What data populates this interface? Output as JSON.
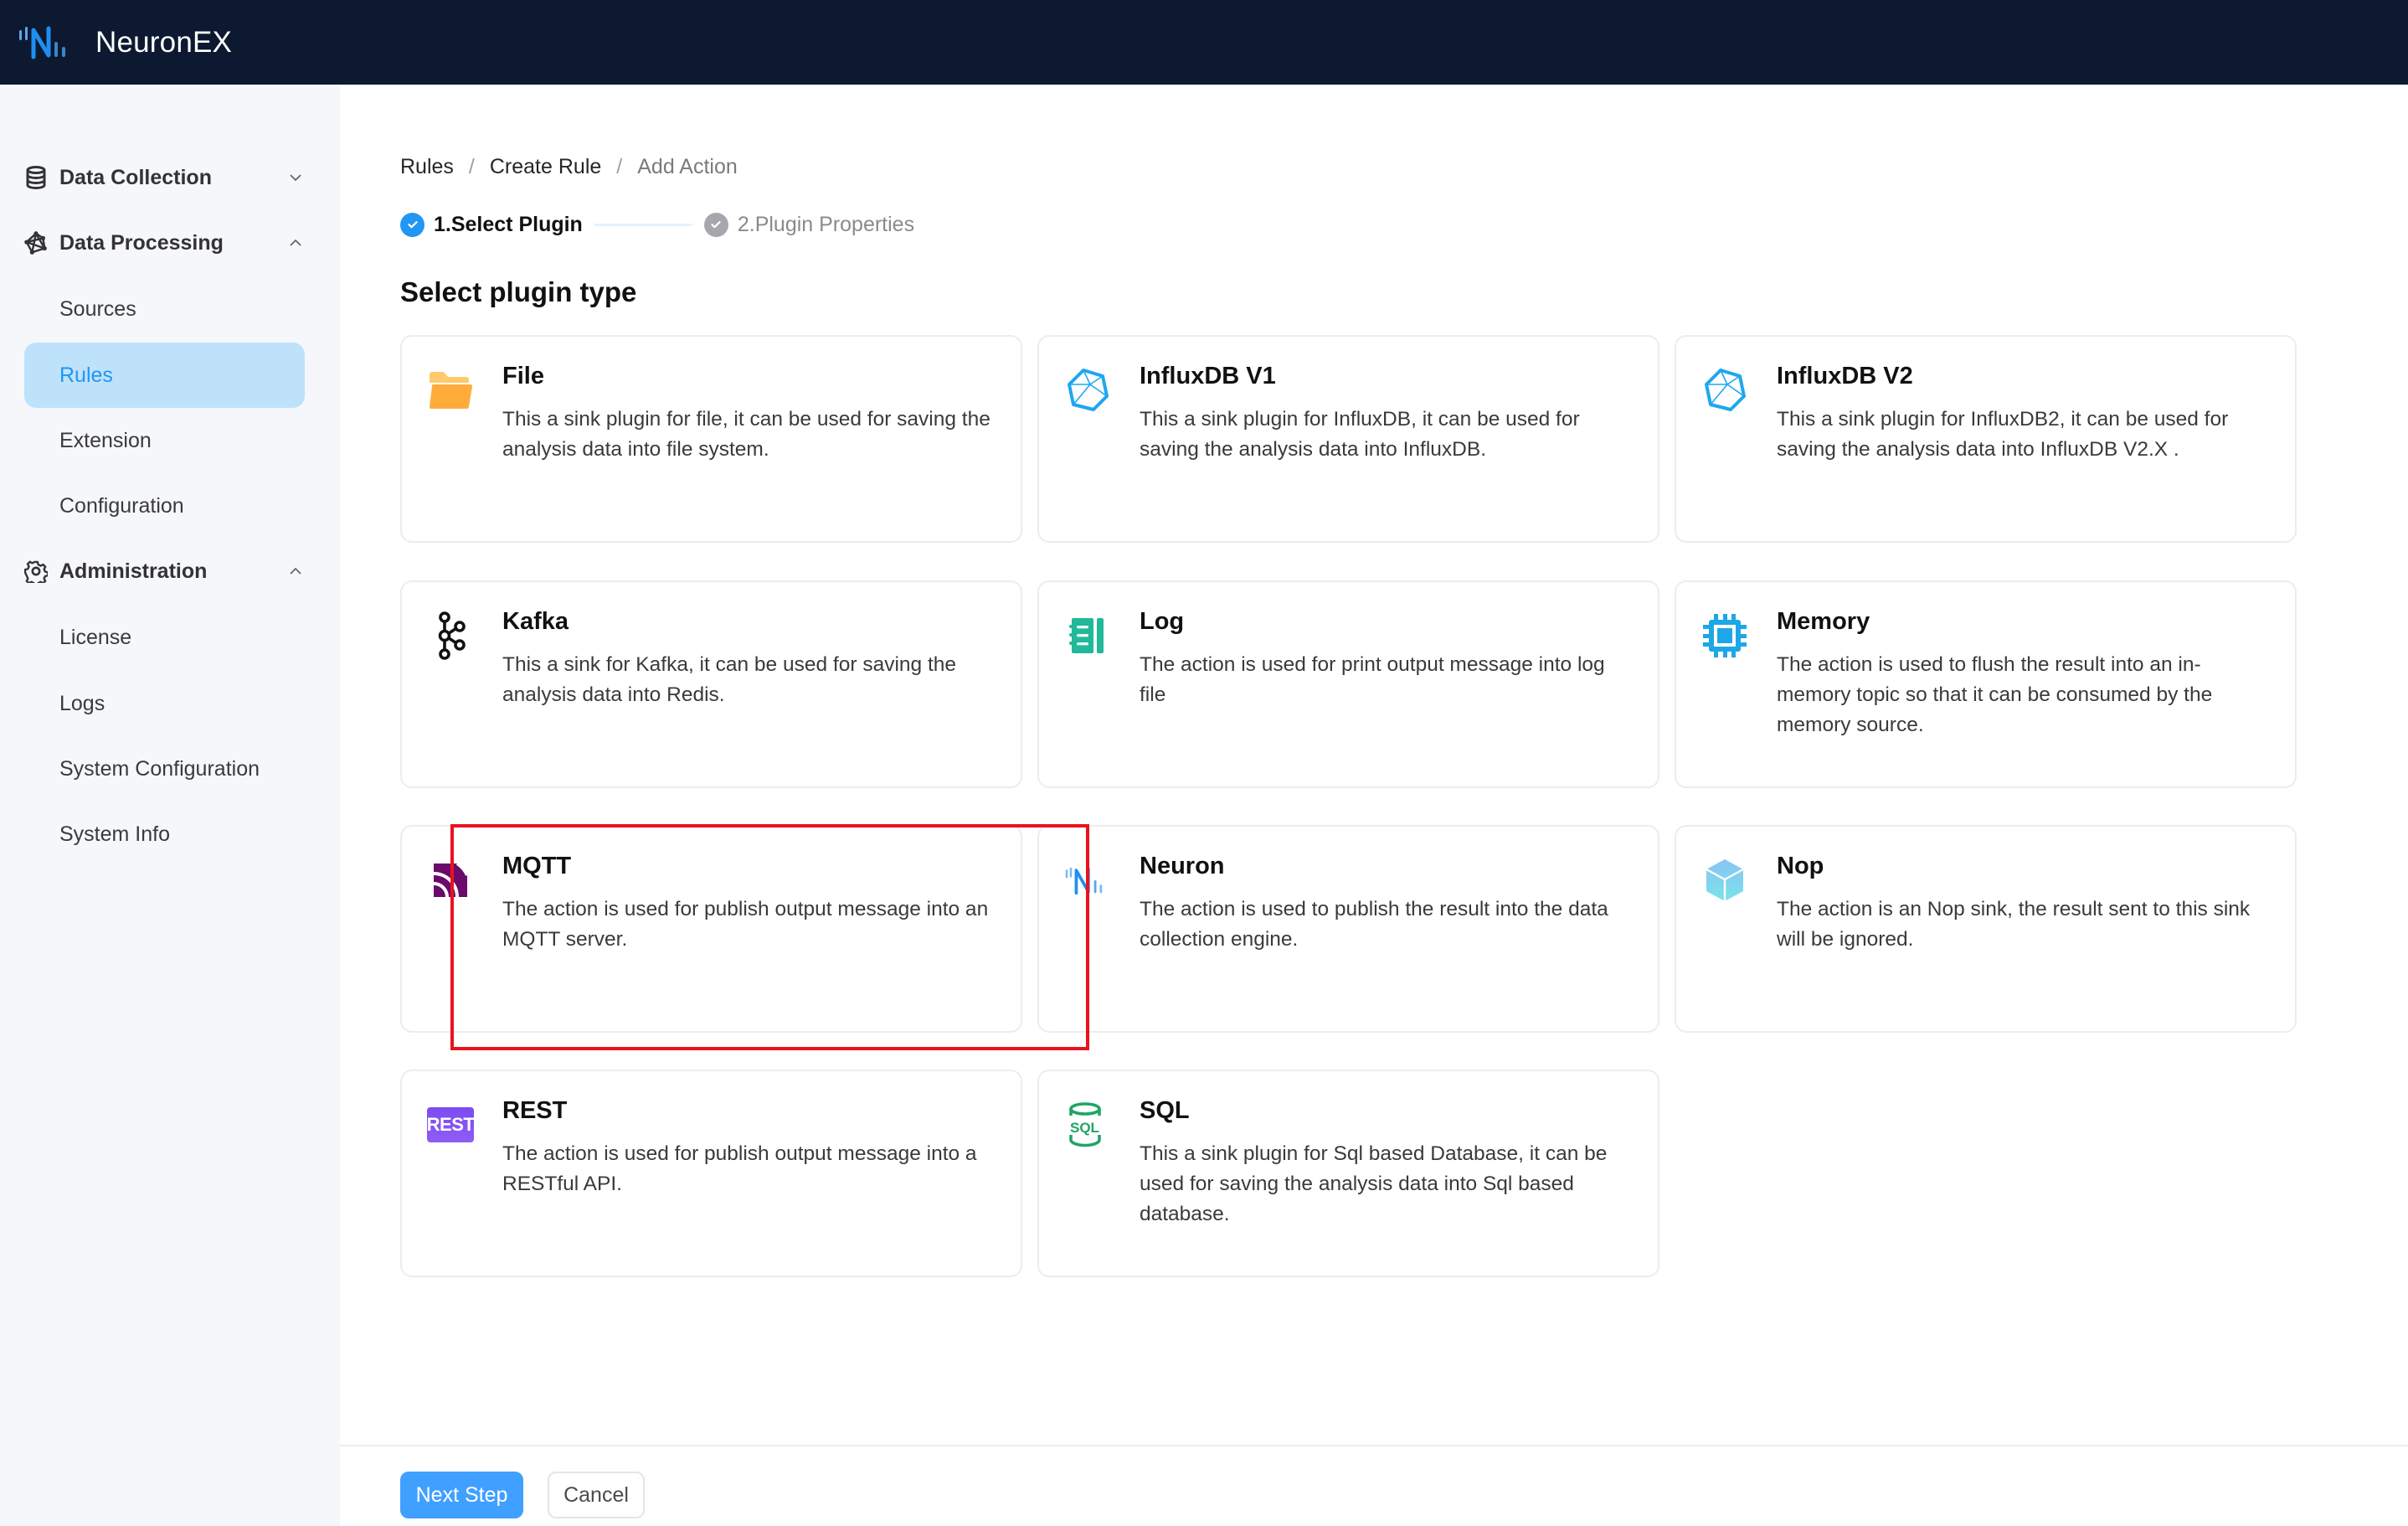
{
  "app": {
    "brand": "NeuronEX",
    "logo_icon": "neuron-logo-icon"
  },
  "sidebar": {
    "groups": [
      {
        "label": "Data Collection",
        "icon": "database-icon",
        "expanded": false
      },
      {
        "label": "Data Processing",
        "icon": "network-graph-icon",
        "expanded": true,
        "items": [
          {
            "label": "Sources",
            "active": false
          },
          {
            "label": "Rules",
            "active": true
          },
          {
            "label": "Extension",
            "active": false
          },
          {
            "label": "Configuration",
            "active": false
          }
        ]
      },
      {
        "label": "Administration",
        "icon": "gear-icon",
        "expanded": true,
        "items": [
          {
            "label": "License",
            "active": false
          },
          {
            "label": "Logs",
            "active": false
          },
          {
            "label": "System Configuration",
            "active": false
          },
          {
            "label": "System Info",
            "active": false
          }
        ]
      }
    ]
  },
  "breadcrumb": {
    "items": [
      "Rules",
      "Create Rule",
      "Add Action"
    ],
    "separator": "/"
  },
  "steps": [
    {
      "label": "1.Select Plugin",
      "status": "active"
    },
    {
      "label": "2.Plugin Properties",
      "status": "wait"
    }
  ],
  "section_title": "Select plugin type",
  "plugins": [
    {
      "name": "File",
      "icon": "folder-icon",
      "description": "This a sink plugin for file, it can be used for saving the analysis data into file system."
    },
    {
      "name": "InfluxDB V1",
      "icon": "influxdb-icon",
      "description": "This a sink plugin for InfluxDB, it can be used for saving the analysis data into InfluxDB."
    },
    {
      "name": "InfluxDB V2",
      "icon": "influxdb-icon",
      "description": "This a sink plugin for InfluxDB2, it can be used for saving the analysis data into InfluxDB V2.X ."
    },
    {
      "name": "Kafka",
      "icon": "kafka-icon",
      "description": "This a sink for Kafka, it can be used for saving the analysis data into Redis.",
      "highlighted": true
    },
    {
      "name": "Log",
      "icon": "log-book-icon",
      "description": "The action is used for print output message into log file"
    },
    {
      "name": "Memory",
      "icon": "memory-chip-icon",
      "description": "The action is used to flush the result into an in-memory topic so that it can be consumed by the memory source."
    },
    {
      "name": "MQTT",
      "icon": "mqtt-icon",
      "description": "The action is used for publish output message into an MQTT server."
    },
    {
      "name": "Neuron",
      "icon": "neuron-icon",
      "description": "The action is used to publish the result into the data collection engine."
    },
    {
      "name": "Nop",
      "icon": "cube-icon",
      "description": "The action is an Nop sink, the result sent to this sink will be ignored."
    },
    {
      "name": "REST",
      "icon": "rest-icon",
      "icon_text": "REST",
      "description": "The action is used for publish output message into a RESTful API."
    },
    {
      "name": "SQL",
      "icon": "sql-database-icon",
      "icon_text": "SQL",
      "description": "This a sink plugin for Sql based Database, it can be used for saving the analysis data into Sql based database."
    }
  ],
  "footer": {
    "next_label": "Next Step",
    "cancel_label": "Cancel"
  },
  "colors": {
    "header_bg": "#0d1930",
    "primary": "#40a0ff",
    "active_nav_bg": "#bfe2fb",
    "active_nav_text": "#2196f3",
    "highlight": "#e8131e"
  }
}
